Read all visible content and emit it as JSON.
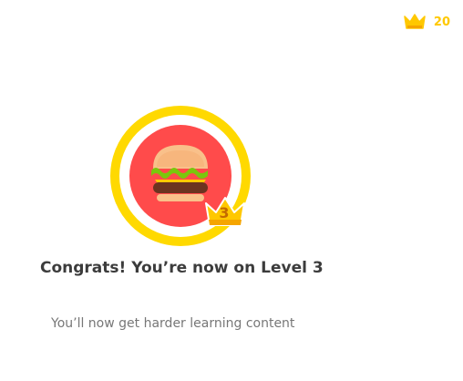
{
  "header": {
    "crown_icon": "crown-icon",
    "crown_count": "20",
    "accent_color": "#ffc800"
  },
  "badge": {
    "icon": "burger-icon",
    "ring_color": "#ffd900",
    "circle_color": "#ff4b4b",
    "level_badge_icon": "crown-icon",
    "level": "3"
  },
  "message": {
    "title": "Congrats! You’re now on Level 3",
    "subtitle": "You’ll now get harder learning content"
  }
}
